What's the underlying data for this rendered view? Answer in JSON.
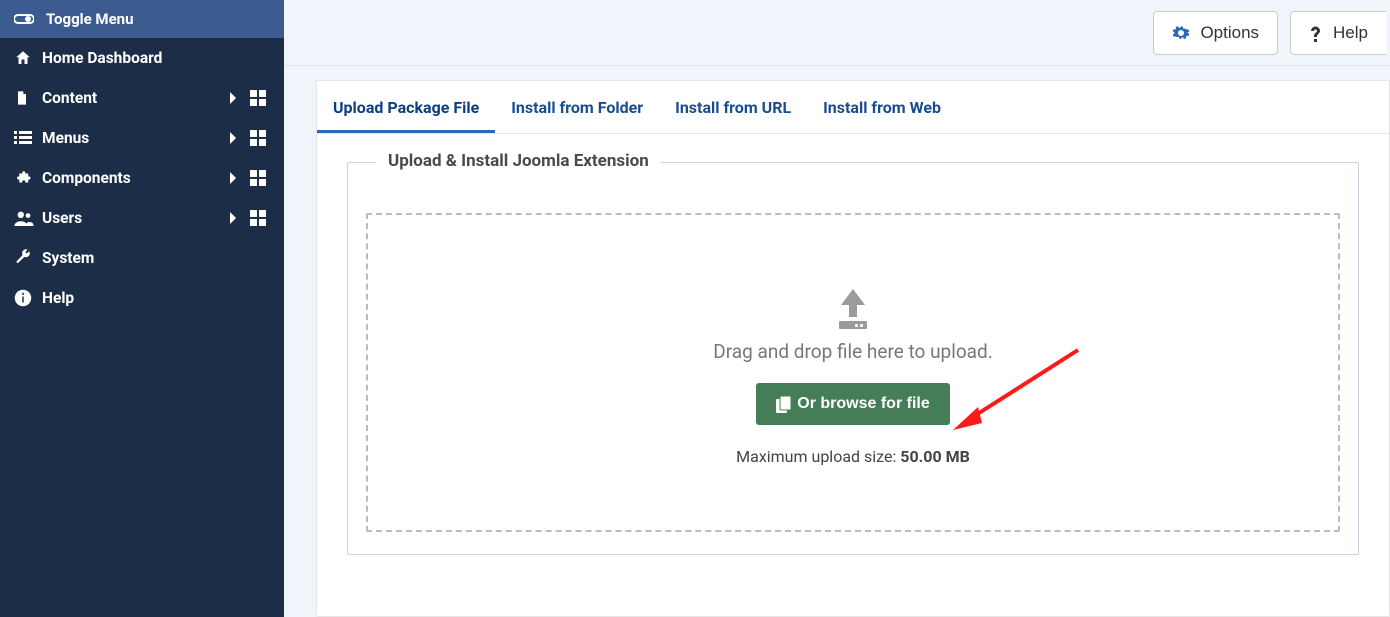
{
  "sidebar": {
    "toggle_label": "Toggle Menu",
    "items": [
      {
        "label": "Home Dashboard",
        "icon": "home",
        "expandable": false,
        "has_dashboard": false
      },
      {
        "label": "Content",
        "icon": "file",
        "expandable": true,
        "has_dashboard": true
      },
      {
        "label": "Menus",
        "icon": "list",
        "expandable": true,
        "has_dashboard": true
      },
      {
        "label": "Components",
        "icon": "plug",
        "expandable": true,
        "has_dashboard": true
      },
      {
        "label": "Users",
        "icon": "users",
        "expandable": true,
        "has_dashboard": true
      },
      {
        "label": "System",
        "icon": "wrench",
        "expandable": false,
        "has_dashboard": false
      },
      {
        "label": "Help",
        "icon": "info",
        "expandable": false,
        "has_dashboard": false
      }
    ]
  },
  "topbar": {
    "options_label": "Options",
    "help_label": "Help"
  },
  "tabs": [
    {
      "label": "Upload Package File",
      "active": true
    },
    {
      "label": "Install from Folder",
      "active": false
    },
    {
      "label": "Install from URL",
      "active": false
    },
    {
      "label": "Install from Web",
      "active": false
    }
  ],
  "upload_panel": {
    "legend": "Upload & Install Joomla Extension",
    "drag_text": "Drag and drop file here to upload.",
    "browse_label": "Or browse for file",
    "max_label": "Maximum upload size: ",
    "max_value": "50.00 MB"
  },
  "colors": {
    "sidebar_bg": "#1c2d48",
    "sidebar_header_bg": "#3b5b8f",
    "tab_active_border": "#2a69b7",
    "browse_btn_bg": "#457d58",
    "annotation_arrow": "#ff1a1a"
  }
}
